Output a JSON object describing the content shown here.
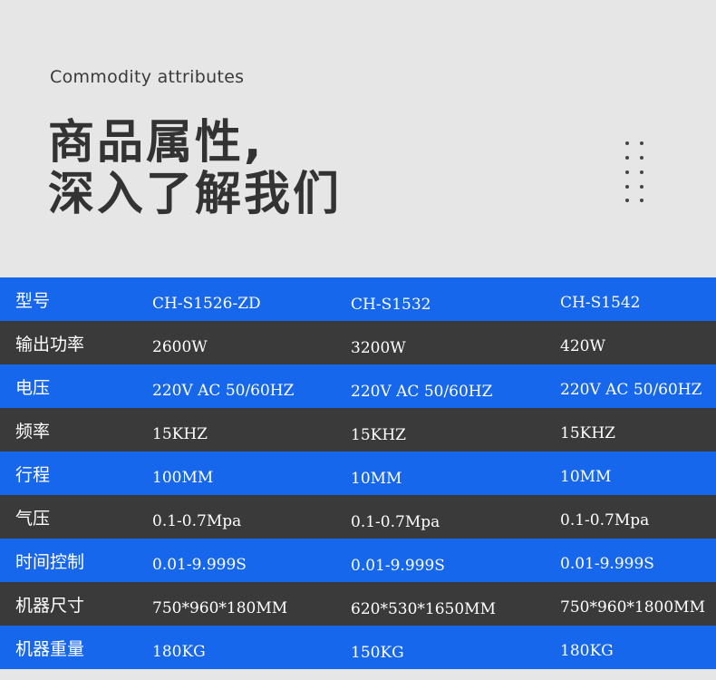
{
  "header": {
    "subtitle": "Commodity attributes",
    "title_line1": "商品属性,",
    "title_line2": "深入了解我们"
  },
  "table": {
    "rows": [
      {
        "label": "型号",
        "values": [
          "CH-S1526-ZD",
          "CH-S1532",
          "CH-S1542"
        ],
        "color": "blue"
      },
      {
        "label": "输出功率",
        "values": [
          "2600W",
          "3200W",
          "420W"
        ],
        "color": "dark"
      },
      {
        "label": "电压",
        "values": [
          "220V AC 50/60HZ",
          "220V AC 50/60HZ",
          "220V AC 50/60HZ"
        ],
        "color": "blue"
      },
      {
        "label": "频率",
        "values": [
          "15KHZ",
          "15KHZ",
          "15KHZ"
        ],
        "color": "dark"
      },
      {
        "label": "行程",
        "values": [
          "100MM",
          "10MM",
          "10MM"
        ],
        "color": "blue"
      },
      {
        "label": "气压",
        "values": [
          "0.1-0.7Mpa",
          "0.1-0.7Mpa",
          "0.1-0.7Mpa"
        ],
        "color": "dark"
      },
      {
        "label": "时间控制",
        "values": [
          "0.01-9.999S",
          "0.01-9.999S",
          "0.01-9.999S"
        ],
        "color": "blue"
      },
      {
        "label": "机器尺寸",
        "values": [
          "750*960*180MM",
          "620*530*1650MM",
          "750*960*1800MM"
        ],
        "color": "dark"
      },
      {
        "label": "机器重量",
        "values": [
          "180KG",
          "150KG",
          "180KG"
        ],
        "color": "blue"
      }
    ]
  },
  "colors": {
    "blue": "#1767ec",
    "dark": "#3a3a3a",
    "background": "#e6e6e6",
    "title": "#333333"
  }
}
